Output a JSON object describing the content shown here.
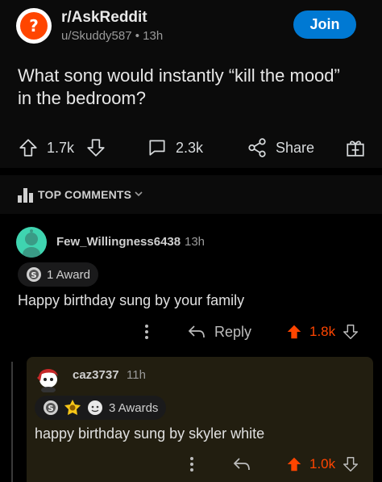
{
  "post": {
    "subreddit": "r/AskReddit",
    "meta": "u/Skuddy587 • 13h",
    "join_label": "Join",
    "title": "What song would instantly “kill the mood” in the bedroom?",
    "votes": "1.7k",
    "comments": "2.3k",
    "share_label": "Share"
  },
  "sort": {
    "label": "TOP COMMENTS"
  },
  "comments": [
    {
      "author": "Few_Willingness6438",
      "time": "13h",
      "awards_label": "1 Award",
      "text": "Happy birthday sung by your family",
      "reply_label": "Reply",
      "votes": "1.8k"
    },
    {
      "author": "caz3737",
      "time": "11h",
      "awards_label": "3 Awards",
      "text": "happy birthday sung by skyler white",
      "votes": "1.0k"
    }
  ],
  "colors": {
    "accent": "#0079d3",
    "upvote": "#ff4500",
    "highlight_bg": "#221e10"
  }
}
